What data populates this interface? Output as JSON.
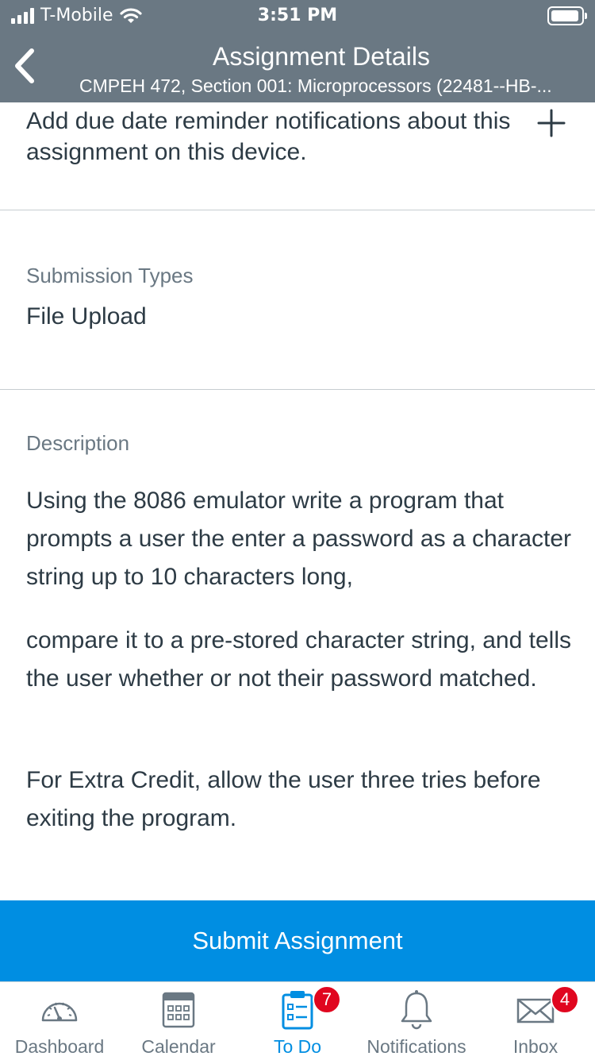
{
  "status_bar": {
    "carrier": "T-Mobile",
    "time": "3:51 PM"
  },
  "nav": {
    "title": "Assignment Details",
    "subtitle": "CMPEH 472, Section 001: Microprocessors (22481--HB-..."
  },
  "reminder": {
    "text": "Add due date reminder notifications about this assignment on this device."
  },
  "submission_types": {
    "label": "Submission Types",
    "value": "File Upload"
  },
  "description": {
    "label": "Description",
    "paragraphs": [
      "Using the 8086 emulator write a program that prompts a user the enter a password as a character string up to 10 characters long,",
      "compare it to a pre-stored character string, and tells the user whether or not their password matched.",
      "For Extra Credit, allow the user three tries before exiting the program."
    ]
  },
  "submit": {
    "label": "Submit Assignment"
  },
  "tabs": [
    {
      "label": "Dashboard",
      "icon": "dashboard-icon",
      "active": false
    },
    {
      "label": "Calendar",
      "icon": "calendar-icon",
      "active": false
    },
    {
      "label": "To Do",
      "icon": "todo-icon",
      "active": true,
      "badge": "7"
    },
    {
      "label": "Notifications",
      "icon": "bell-icon",
      "active": false
    },
    {
      "label": "Inbox",
      "icon": "envelope-icon",
      "active": false,
      "badge": "4"
    }
  ],
  "colors": {
    "header": "#6a7883",
    "accent": "#008ee2",
    "badge": "#e0061f",
    "text": "#2d3b45"
  }
}
